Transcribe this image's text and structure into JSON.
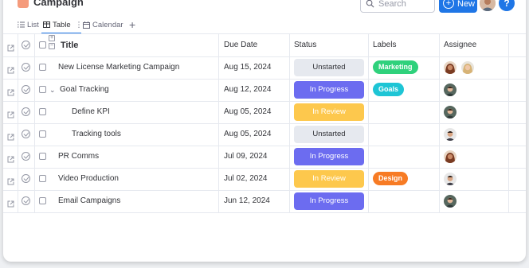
{
  "header": {
    "project_title": "Campaign",
    "search_placeholder": "Search",
    "new_button_label": "New",
    "help_label": "?"
  },
  "tabs": [
    {
      "label": "List",
      "icon": "list-icon",
      "active": false
    },
    {
      "label": "Table",
      "icon": "table-icon",
      "active": true
    },
    {
      "label": "Calendar",
      "icon": "calendar-icon",
      "active": false
    }
  ],
  "table": {
    "columns": {
      "title": "Title",
      "due_date": "Due Date",
      "status": "Status",
      "labels": "Labels",
      "assignee": "Assignee"
    },
    "rows": [
      {
        "title": "New License Marketing Campaign",
        "due": "Aug 15, 2024",
        "status": "Unstarted",
        "label": "Marketing",
        "assignees": [
          "avatar-woman-dark",
          "avatar-woman-blonde"
        ]
      },
      {
        "title": "Goal Tracking",
        "due": "Aug 12, 2024",
        "status": "In Progress",
        "label": "Goals",
        "assignees": [
          "avatar-man-1"
        ]
      },
      {
        "title": "Define KPI",
        "due": "Aug 05, 2024",
        "status": "In Review",
        "label": "",
        "assignees": [
          "avatar-man-1"
        ]
      },
      {
        "title": "Tracking tools",
        "due": "Aug 05, 2024",
        "status": "Unstarted",
        "label": "",
        "assignees": [
          "avatar-man-2"
        ]
      },
      {
        "title": "PR Comms",
        "due": "Jul 09, 2024",
        "status": "In Progress",
        "label": "",
        "assignees": [
          "avatar-woman-dark"
        ]
      },
      {
        "title": "Video Production",
        "due": "Jul 02, 2024",
        "status": "In Review",
        "label": "Design",
        "assignees": [
          "avatar-man-2"
        ]
      },
      {
        "title": "Email Campaigns",
        "due": "Jun 12, 2024",
        "status": "In Progress",
        "label": "",
        "assignees": [
          "avatar-man-1"
        ]
      }
    ]
  },
  "colors": {
    "accent": "#1f76e6",
    "status_unstarted": "#e6e9ef",
    "status_in_progress": "#6c6cf0",
    "status_in_review": "#fdc84d",
    "label_marketing": "#2fd17c",
    "label_goals": "#1ec5d5",
    "label_design": "#f77b24"
  }
}
